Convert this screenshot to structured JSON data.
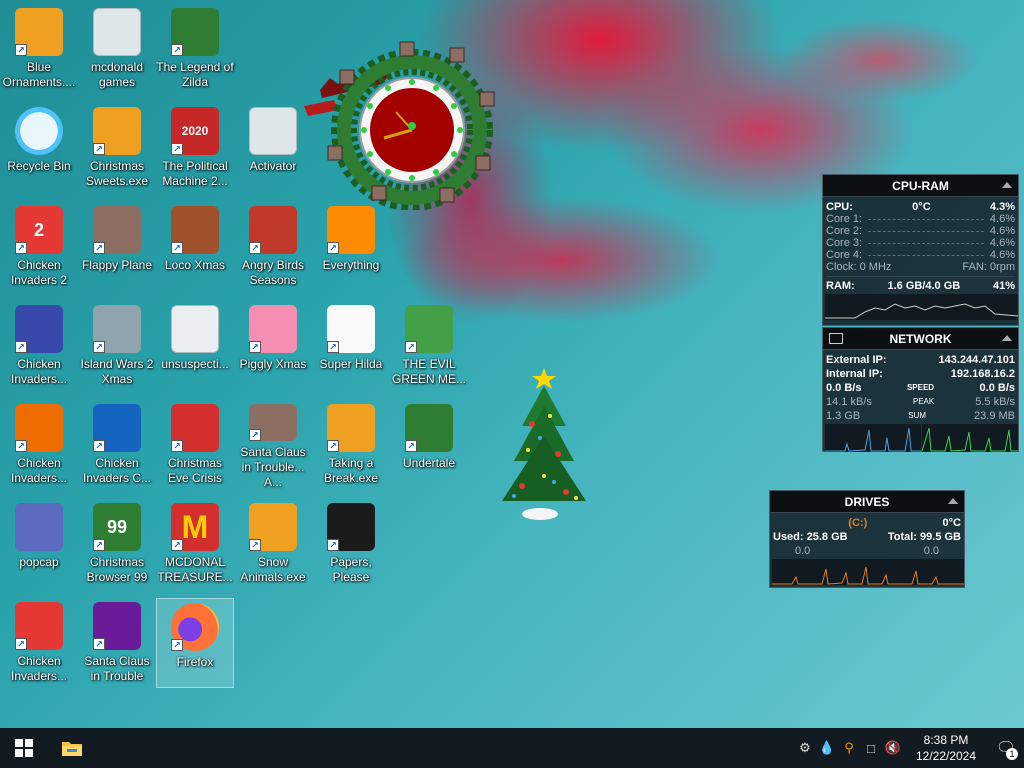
{
  "desktop": {
    "icons": [
      {
        "label": "Blue Ornaments....",
        "icon": "puzzle-exe-icon",
        "color": "#f0a020"
      },
      {
        "label": "mcdonald games",
        "icon": "folder-icon",
        "color": "#dfe6ea"
      },
      {
        "label": "The Legend of Zilda",
        "icon": "game-character-icon",
        "color": "#2e7d32"
      },
      {
        "label": "Recycle Bin",
        "icon": "recycle-bin-icon",
        "color": "#4fc3f7"
      },
      {
        "label": "Christmas Sweets.exe",
        "icon": "puzzle-exe-icon",
        "color": "#f0a020"
      },
      {
        "label": "The Political Machine 2...",
        "icon": "political-machine-icon",
        "color": "#c62828",
        "badge": "2020"
      },
      {
        "label": "Activator",
        "icon": "folder-icon",
        "color": "#dfe6ea"
      },
      {
        "label": "Chicken Invaders 2",
        "icon": "chicken-invaders-icon",
        "color": "#e53935",
        "badge": "2"
      },
      {
        "label": "Flappy Plane",
        "icon": "flappy-plane-icon",
        "color": "#8d6e63"
      },
      {
        "label": "Loco Xmas",
        "icon": "teddy-bear-icon",
        "color": "#a0522d"
      },
      {
        "label": "Angry Birds Seasons",
        "icon": "angry-birds-icon",
        "color": "#c0392b"
      },
      {
        "label": "Everything",
        "icon": "magnifier-icon",
        "color": "#ff8c00"
      },
      {
        "label": "Chicken Invaders...",
        "icon": "chicken-invaders-icon",
        "color": "#3949ab"
      },
      {
        "label": "Island Wars 2 Xmas",
        "icon": "island-wars-icon",
        "color": "#90a4ae"
      },
      {
        "label": "unsuspecti...",
        "icon": "file-icon",
        "color": "#eceff1"
      },
      {
        "label": "Piggly Xmas",
        "icon": "pig-icon",
        "color": "#f48fb1"
      },
      {
        "label": "Super Hilda",
        "icon": "pixel-character-icon",
        "color": "#fafafa"
      },
      {
        "label": "THE EVIL GREEN ME...",
        "icon": "messenger-icon",
        "color": "#43a047"
      },
      {
        "label": "Chicken Invaders...",
        "icon": "chicken-invaders-icon",
        "color": "#ef6c00"
      },
      {
        "label": "Chicken Invaders C...",
        "icon": "snowman-icon",
        "color": "#1565c0"
      },
      {
        "label": "Christmas Eve Crisis",
        "icon": "santa-icon",
        "color": "#d32f2f"
      },
      {
        "label": "Santa Claus in Trouble... A...",
        "icon": "santa-icon",
        "color": "#8d6e63"
      },
      {
        "label": "Taking a Break.exe",
        "icon": "puzzle-exe-icon",
        "color": "#f0a020"
      },
      {
        "label": "Undertale",
        "icon": "undertale-icon",
        "color": "#2e7d32"
      },
      {
        "label": "popcap",
        "icon": "popcap-icon",
        "color": "#5c6bc0"
      },
      {
        "label": "Christmas Browser 99",
        "icon": "christmas-tree-icon",
        "color": "#2e7d32",
        "badge": "99"
      },
      {
        "label": "MCDONAL TREASURE...",
        "icon": "mcdonalds-icon",
        "color": "#d32f2f",
        "badge": "M"
      },
      {
        "label": "Snow Animals.exe",
        "icon": "puzzle-exe-icon",
        "color": "#f0a020"
      },
      {
        "label": "Papers, Please",
        "icon": "papers-please-icon",
        "color": "#1a1a1a"
      },
      {
        "label": "Chicken Invaders...",
        "icon": "chicken-invaders-icon",
        "color": "#e53935"
      },
      {
        "label": "Santa Claus in Trouble",
        "icon": "santa-icon",
        "color": "#6a1b9a"
      },
      {
        "label": "Firefox",
        "icon": "firefox-icon",
        "color": "#ff7139"
      }
    ]
  },
  "cpu_ram": {
    "title": "CPU-RAM",
    "cpu_label": "CPU:",
    "cpu_temp": "0°C",
    "cpu_pct": "4.3%",
    "cores": [
      {
        "label": "Core 1:",
        "value": "4.6%"
      },
      {
        "label": "Core 2:",
        "value": "4.6%"
      },
      {
        "label": "Core 3:",
        "value": "4.6%"
      },
      {
        "label": "Core 4:",
        "value": "4.6%"
      }
    ],
    "clock_label": "Clock: 0 MHz",
    "fan_label": "FAN: 0rpm",
    "ram_label": "RAM:",
    "ram_usage": "1.6 GB/4.0 GB",
    "ram_pct": "41%"
  },
  "network": {
    "title": "NETWORK",
    "external_label": "External IP:",
    "external_ip": "143.244.47.101",
    "internal_label": "Internal IP:",
    "internal_ip": "192.168.16.2",
    "speed_left": "0.0 B/s",
    "speed_label": "SPEED",
    "speed_right": "0.0 B/s",
    "peak_left": "14.1 kB/s",
    "peak_label": "PEAK",
    "peak_right": "5.5 kB/s",
    "sum_left": "1.3 GB",
    "sum_label": "SUM",
    "sum_right": "23.9 MB"
  },
  "drives": {
    "title": "DRIVES",
    "drive_letter": "(C:)",
    "temp": "0°C",
    "used": "Used: 25.8 GB",
    "total": "Total: 99.5 GB",
    "read": "0.0",
    "write": "0.0"
  },
  "taskbar": {
    "time": "8:38 PM",
    "date": "12/22/2024",
    "notification_count": "1"
  }
}
